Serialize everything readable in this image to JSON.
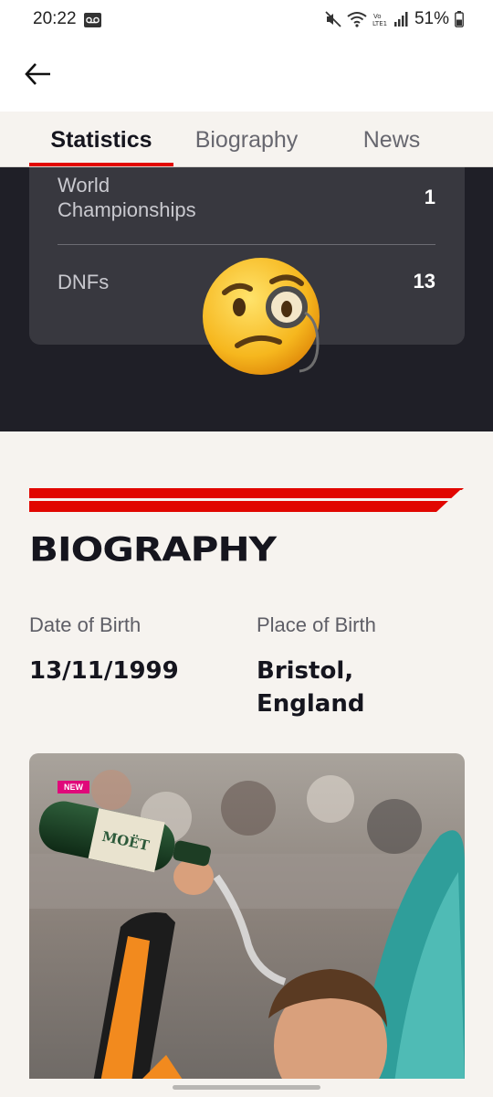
{
  "status_bar": {
    "time": "20:22",
    "battery": "51%",
    "icons": [
      "voicemail-icon",
      "mute-icon",
      "wifi-icon",
      "volte-icon",
      "signal-icon",
      "battery-icon"
    ]
  },
  "app_bar": {
    "back_icon": "back-arrow-icon"
  },
  "tabs": [
    {
      "label": "Statistics",
      "active": true
    },
    {
      "label": "Biography",
      "active": false
    },
    {
      "label": "News",
      "active": false
    }
  ],
  "stats": [
    {
      "label_line1": "World",
      "label_line2": "Championships",
      "value": "1"
    },
    {
      "label": "DNFs",
      "value": "13"
    }
  ],
  "overlay_emoji": "face-with-monocle-emoji",
  "biography": {
    "heading": "BIOGRAPHY",
    "date_of_birth_label": "Date of Birth",
    "date_of_birth_value": "13/11/1999",
    "place_of_birth_label": "Place of Birth",
    "place_of_birth_line1": "Bristol,",
    "place_of_birth_line2": "England"
  },
  "news_card": {
    "badge": "NEW",
    "bottle_text": "MOËT"
  },
  "colors": {
    "accent_red": "#e10600",
    "dark_bg": "#1f1f27",
    "card_bg": "#38383f",
    "page_bg": "#f6f3ef",
    "badge_pink": "#e0087a"
  }
}
